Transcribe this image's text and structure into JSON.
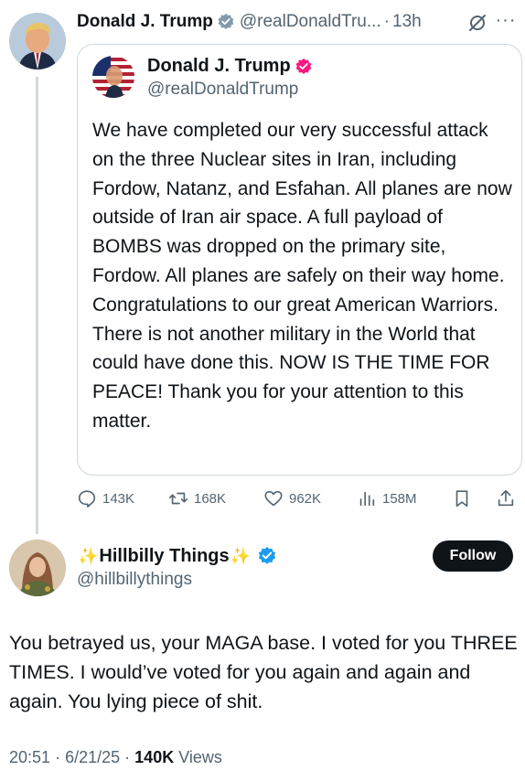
{
  "tweet": {
    "author_name": "Donald J. Trump",
    "author_handle": "@realDonaldTru...",
    "separator": "·",
    "time_ago": "13h",
    "more_icon": "more-dots-icon",
    "grok_icon": "grok-icon",
    "quote": {
      "author_name": "Donald J. Trump",
      "author_handle": "@realDonaldTrump",
      "text": "We have completed our very successful attack on the three Nuclear sites in Iran, including Fordow, Natanz, and Esfahan. All planes are now outside of Iran air space. A full payload of BOMBS was dropped on the primary site, Fordow. All planes are safely on their way home. Congratulations to our great American Warriors. There is not another military in the World that could have done this. NOW IS THE TIME FOR PEACE! Thank you for your attention to this matter."
    },
    "actions": {
      "replies": "143K",
      "reposts": "168K",
      "likes": "962K",
      "views": "158M"
    }
  },
  "reply": {
    "author_name": "Hillbilly Things",
    "author_handle": "@hillbillythings",
    "follow_label": "Follow",
    "text": "You betrayed us, your MAGA base. I voted for you THREE TIMES. I would’ve voted for you again and again and again. You lying piece of shit.",
    "time": "20:51",
    "sep1": "·",
    "date": "6/21/25",
    "sep2": "·",
    "views_count": "140K",
    "views_label": "Views"
  },
  "colors": {
    "text": "#0f1419",
    "secondary": "#536471",
    "verified_blue": "#1d9bf0",
    "verified_gray": "#829aab",
    "border": "#cfd9de"
  }
}
